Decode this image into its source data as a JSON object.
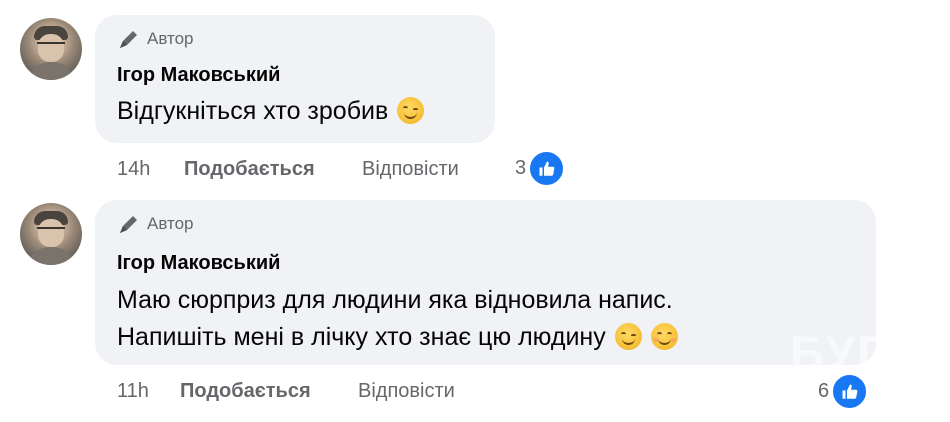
{
  "comments": [
    {
      "author_badge": "Автор",
      "name": "Ігор Маковський",
      "lines": [
        "Відгукніться хто зробив"
      ],
      "emoji": [
        "wink-emoji"
      ],
      "time": "14h",
      "like_label": "Подобається",
      "reply_label": "Відповісти",
      "reaction_count": "3"
    },
    {
      "author_badge": "Автор",
      "name": "Ігор Маковський",
      "lines": [
        "Маю сюрприз для людини яка відновила напис.",
        "Напишіть мені в лічку хто знає цю людину"
      ],
      "emoji": [
        "wink-emoji",
        "smile-emoji"
      ],
      "time": "11h",
      "like_label": "Подобається",
      "reply_label": "Відповісти",
      "reaction_count": "6"
    }
  ],
  "watermark": "БУГ",
  "colors": {
    "bubble": "#f0f2f5",
    "meta_text": "#65676b",
    "like_blue": "#1877f2"
  }
}
